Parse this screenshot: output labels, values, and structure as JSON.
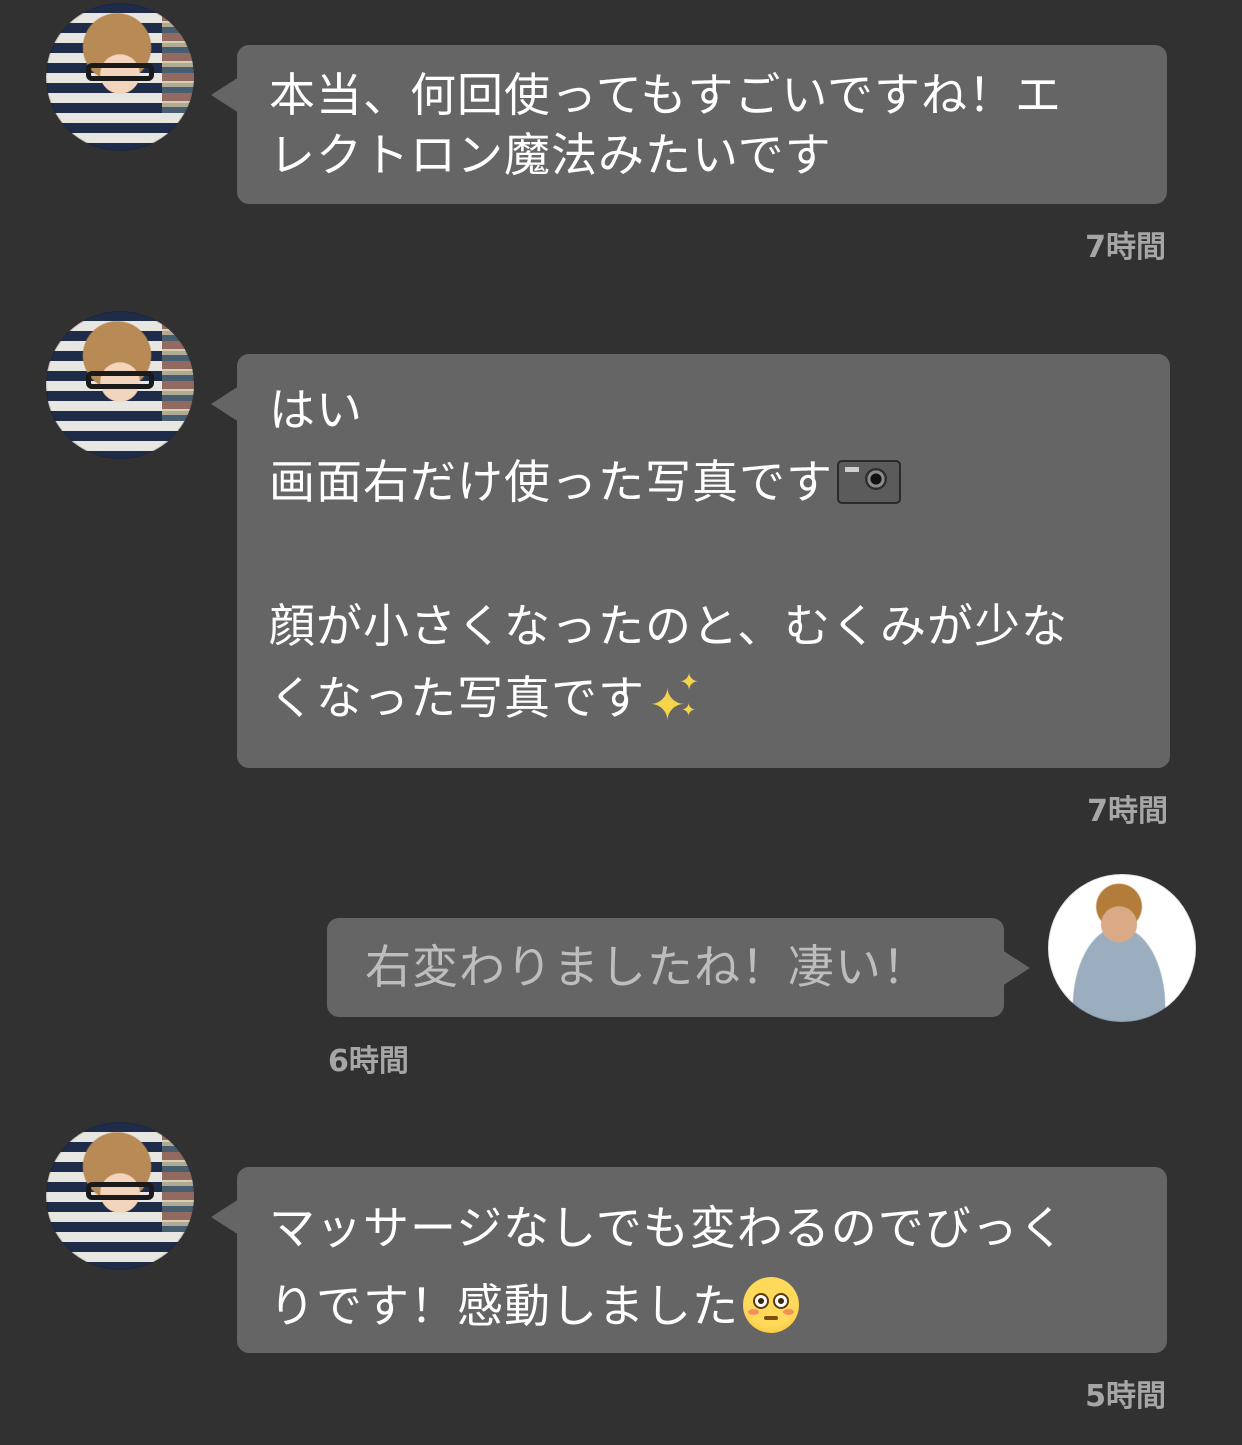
{
  "messages": [
    {
      "sender": "other",
      "avatar": "female-user-avatar",
      "lines": [
        "本当、何回使ってもすごいですね！エ",
        "レクトロン魔法みたいです"
      ],
      "time": "7時間"
    },
    {
      "sender": "other",
      "avatar": "female-user-avatar",
      "lines": [
        "はい",
        "画面右だけ使った写真です",
        "",
        "顔が小さくなったのと、むくみが少な",
        "くなった写真です"
      ],
      "inline_icons": [
        "camera-emoji",
        "sparkles-emoji"
      ],
      "time": "7時間"
    },
    {
      "sender": "self",
      "avatar": "male-user-avatar",
      "lines": [
        "右変わりましたね！凄い！"
      ],
      "time": "6時間"
    },
    {
      "sender": "other",
      "avatar": "female-user-avatar",
      "lines": [
        "マッサージなしでも変わるのでびっく",
        "りです！感動しました"
      ],
      "inline_icons": [
        "flushed-face-emoji"
      ],
      "time": "5時間"
    }
  ],
  "colors": {
    "background": "#313131",
    "bubble": "#656565",
    "other_text": "#ffffff",
    "self_text": "#bdbdbd",
    "timestamp": "#a6a6a6"
  }
}
